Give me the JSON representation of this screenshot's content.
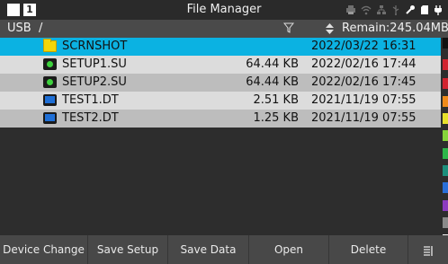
{
  "app_title": "File Manager",
  "top_bar": {
    "stop_icon": "stop-square-icon",
    "one_label": "1",
    "status_icons": [
      "printer-icon",
      "wifi-icon",
      "network-icon",
      "usb-icon",
      "tool-icon",
      "sdcard-icon",
      "plug-icon"
    ]
  },
  "path_bar": {
    "path": "USB  /",
    "filter_icon": "filter-icon",
    "sort_icon": "sort-icon",
    "remain": "Remain:245.04MB"
  },
  "files": [
    {
      "name": "SCRNSHOT",
      "size": "",
      "date": "2022/03/22 16:31",
      "icon": "folder-icon",
      "selected": true
    },
    {
      "name": "SETUP1.SU",
      "size": "64.44 KB",
      "date": "2022/02/16 17:44",
      "icon": "setup-file-icon",
      "selected": false
    },
    {
      "name": "SETUP2.SU",
      "size": "64.44 KB",
      "date": "2022/02/16 17:45",
      "icon": "setup-file-icon",
      "selected": false
    },
    {
      "name": "TEST1.DT",
      "size": "2.51 KB",
      "date": "2021/11/19 07:55",
      "icon": "data-file-icon",
      "selected": false
    },
    {
      "name": "TEST2.DT",
      "size": "1.25 KB",
      "date": "2021/11/19 07:55",
      "icon": "data-file-icon",
      "selected": false
    }
  ],
  "channel_colors": [
    "#111111",
    "#d2242f",
    "#d2242f",
    "#ef8a1a",
    "#e8e12b",
    "#86d43a",
    "#2eb64a",
    "#1c8f7c",
    "#2a6fd8",
    "#8c3bbf",
    "#8a8a8a",
    "#f5f5f5"
  ],
  "softkeys": [
    "Device Change",
    "Save Setup",
    "Save Data",
    "Open",
    "Delete",
    ""
  ],
  "colors": {
    "selected_row": "#0bb2e2",
    "light_row": "#dcdcdc",
    "dark_row": "#bdbdbd",
    "background": "#2d2d2d"
  }
}
